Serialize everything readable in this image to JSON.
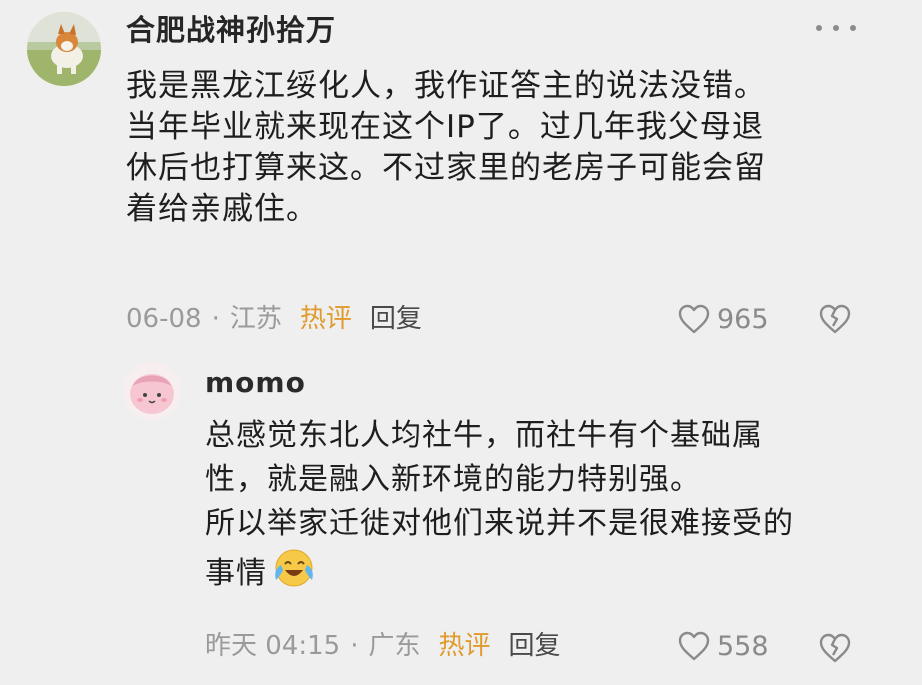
{
  "main_comment": {
    "username": "合肥战神孙拾万",
    "avatar_icon": "corgi-avatar",
    "text_lines": [
      "我是黑龙江绥化人，我作证答主的说法没错。",
      "当年毕业就来现在这个IP了。过几年我父母退",
      "休后也打算来这。不过家里的老房子可能会留",
      "着给亲戚住。"
    ],
    "date": "06-08",
    "separator": "·",
    "location": "江苏",
    "hot_label": "热评",
    "reply_label": "回复",
    "like_count": "965",
    "more_icon": "more-dots-icon"
  },
  "reply_comment": {
    "username": "momo",
    "avatar_icon": "pink-blob-avatar",
    "text_lines": [
      "总感觉东北人均社牛，而社牛有个基础属",
      "性，就是融入新环境的能力特别强。",
      "所以举家迁徙对他们来说并不是很难接受的",
      "事情"
    ],
    "emoji": "laugh-crying-emoji",
    "date": "昨天 04:15",
    "separator": "·",
    "location": "广东",
    "hot_label": "热评",
    "reply_label": "回复",
    "like_count": "558"
  },
  "colors": {
    "background": "#efefef",
    "hot": "#e09b2d",
    "meta": "#9a9a9a"
  }
}
